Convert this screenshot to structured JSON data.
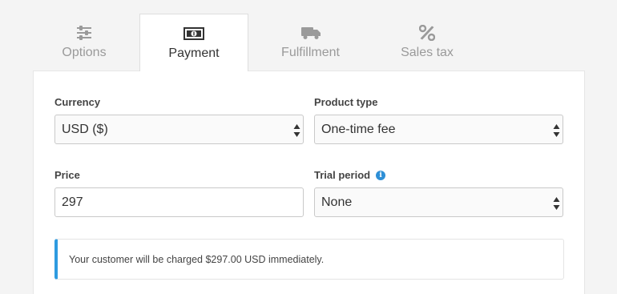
{
  "tabs": [
    {
      "label": "Options",
      "icon": "sliders-icon"
    },
    {
      "label": "Payment",
      "icon": "cash-icon"
    },
    {
      "label": "Fulfillment",
      "icon": "truck-icon"
    },
    {
      "label": "Sales tax",
      "icon": "percent-icon"
    }
  ],
  "active_tab": "Payment",
  "form": {
    "currency": {
      "label": "Currency",
      "value": "USD ($)"
    },
    "product_type": {
      "label": "Product type",
      "value": "One-time fee"
    },
    "price": {
      "label": "Price",
      "value": "297"
    },
    "trial_period": {
      "label": "Trial period",
      "value": "None",
      "info_icon": "info-icon"
    }
  },
  "notice": {
    "text": "Your customer will be charged $297.00 USD immediately.",
    "accent": "#2e9be0"
  },
  "colors": {
    "active_text": "#333333",
    "inactive_text": "#9a9a9a",
    "info": "#2e8fd6"
  }
}
